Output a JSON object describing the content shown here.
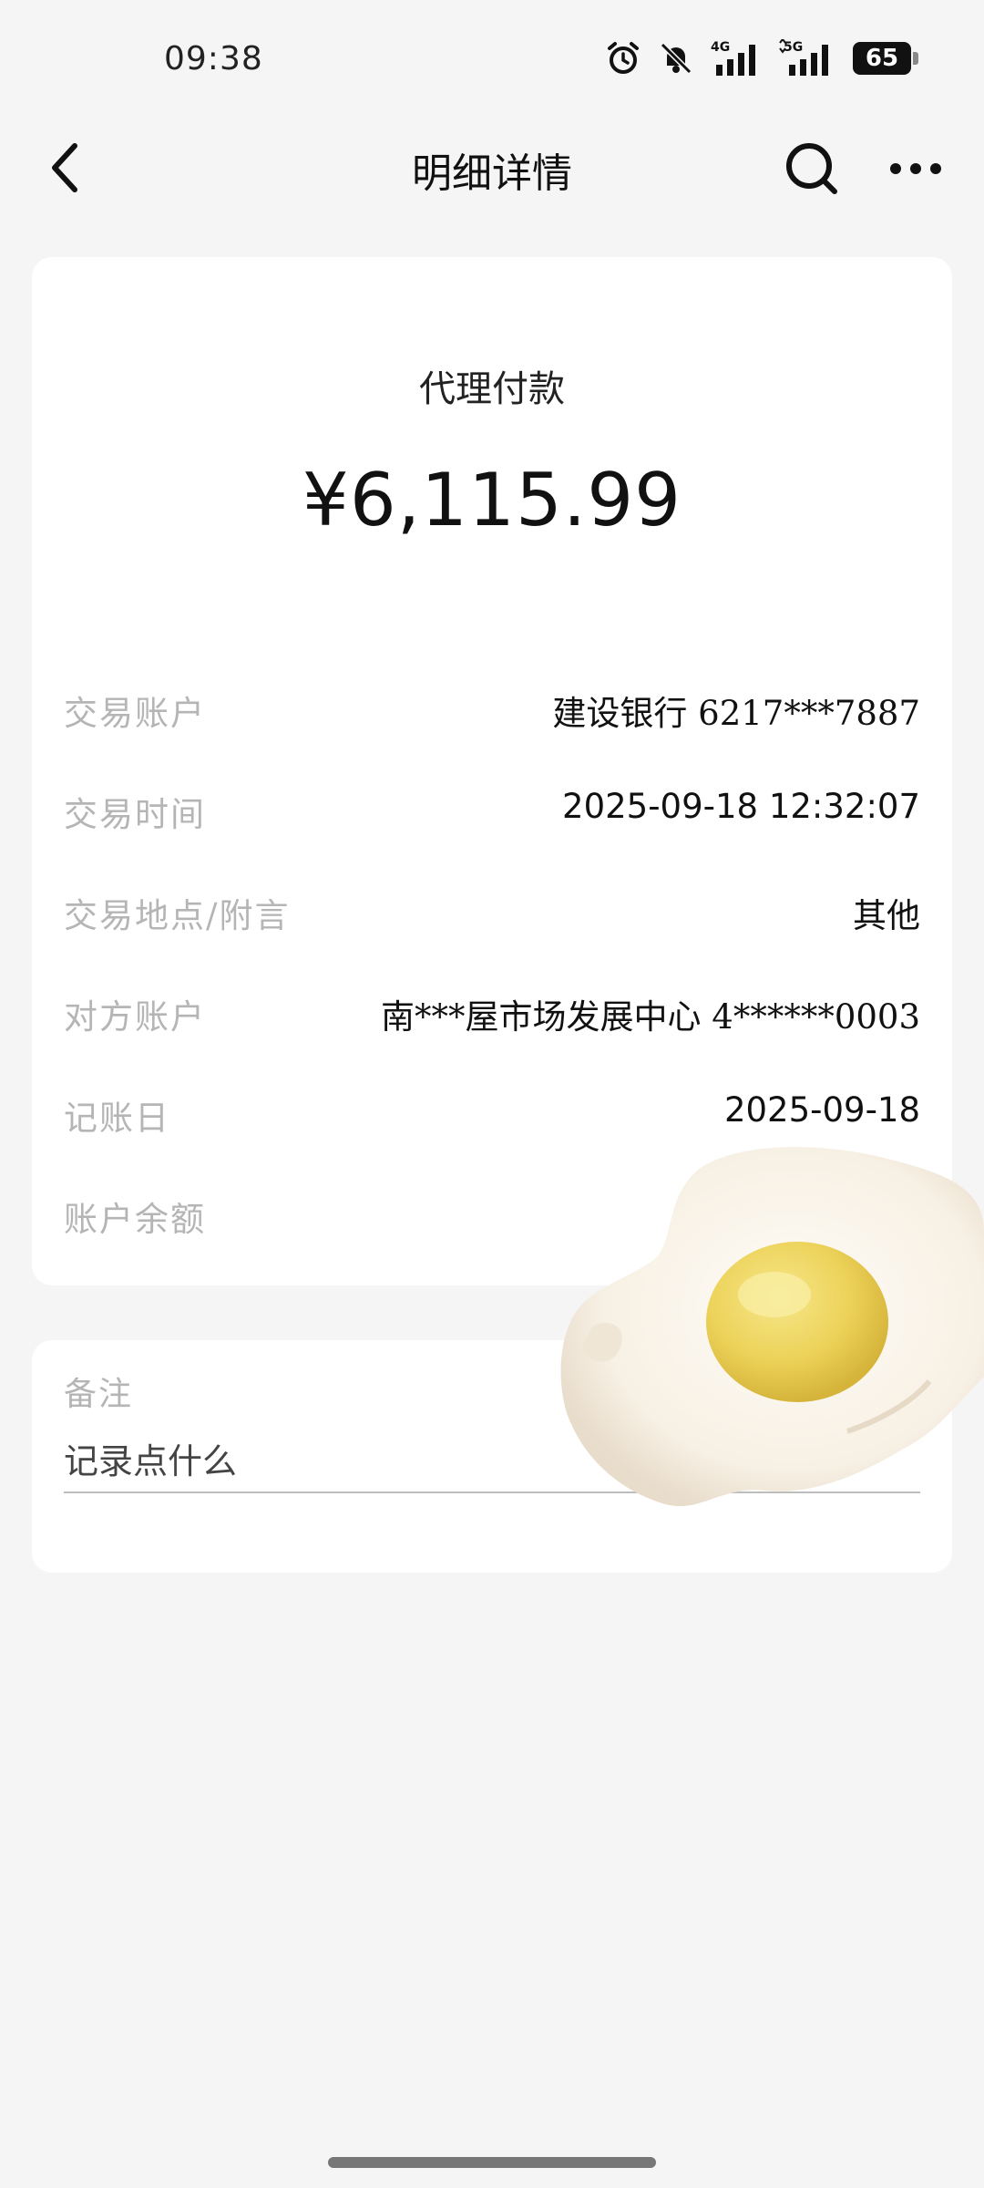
{
  "status_bar": {
    "time": "09:38",
    "signal1_label": "4G",
    "signal2_label": "5G",
    "battery": "65",
    "icons": [
      "alarm-icon",
      "mute-icon",
      "signal-4g-icon",
      "signal-5g-icon",
      "battery-icon"
    ]
  },
  "nav": {
    "title": "明细详情",
    "back_icon": "chevron-left-icon",
    "search_icon": "search-icon",
    "more_icon": "more-icon"
  },
  "transaction": {
    "type": "代理付款",
    "amount": "¥6,115.99",
    "rows": [
      {
        "label": "交易账户",
        "value": "建设银行 6217***7887"
      },
      {
        "label": "交易时间",
        "value": "2025-09-18 12:32:07"
      },
      {
        "label": "交易地点/附言",
        "value": "其他"
      },
      {
        "label": "对方账户",
        "value": "南***屋市场发展中心 4******0003"
      },
      {
        "label": "记账日",
        "value": "2025-09-18"
      },
      {
        "label": "账户余额",
        "value": ""
      }
    ]
  },
  "note": {
    "label": "备注",
    "placeholder": "记录点什么"
  },
  "sticker": {
    "icon": "fried-egg-sticker"
  },
  "colors": {
    "background": "#f5f5f5",
    "card": "#ffffff",
    "label": "#b5b5b5"
  }
}
